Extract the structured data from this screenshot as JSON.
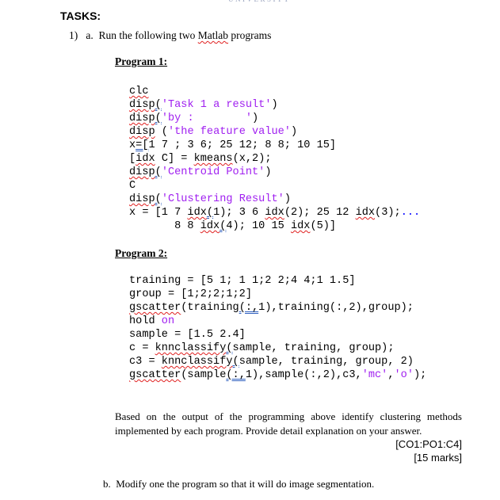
{
  "header": {
    "university_label": "UNIVERSITY",
    "section_title": "TASKS:"
  },
  "task1": {
    "number": "1)",
    "part_a_label": "a.",
    "part_a_text_before": "Run the following two ",
    "part_a_text_flagged": "Matlab",
    "part_a_text_after": " programs"
  },
  "program1": {
    "heading": "Program 1:",
    "lines": [
      [
        {
          "t": "clc",
          "s": "squig"
        }
      ],
      [
        {
          "t": "disp",
          "s": "squig"
        },
        {
          "t": "(",
          "s": "dbl"
        },
        {
          "t": "'Task 1 a result'",
          "s": "str"
        },
        {
          "t": ")"
        }
      ],
      [
        {
          "t": "disp",
          "s": "squig"
        },
        {
          "t": "(",
          "s": "dbl"
        },
        {
          "t": "'by :        '",
          "s": "str"
        },
        {
          "t": ")"
        }
      ],
      [
        {
          "t": "disp",
          "s": "squig"
        },
        {
          "t": " ("
        },
        {
          "t": "'the feature value'",
          "s": "str"
        },
        {
          "t": ")"
        }
      ],
      [
        {
          "t": "x"
        },
        {
          "t": "=[",
          "s": "dbl"
        },
        {
          "t": "1 7 ; 3 6; 25 12; 8 8; 10 15]"
        }
      ],
      [
        {
          "t": "["
        },
        {
          "t": "idx",
          "s": "squig"
        },
        {
          "t": " C] = "
        },
        {
          "t": "kmeans",
          "s": "squig"
        },
        {
          "t": "(x,2);"
        }
      ],
      [
        {
          "t": "disp",
          "s": "squig"
        },
        {
          "t": "(",
          "s": "dbl"
        },
        {
          "t": "'Centroid Point'",
          "s": "str"
        },
        {
          "t": ")"
        }
      ],
      [
        {
          "t": "C"
        }
      ],
      [
        {
          "t": "disp",
          "s": "squig"
        },
        {
          "t": "(",
          "s": "dbl"
        },
        {
          "t": "'Clustering Result'",
          "s": "str"
        },
        {
          "t": ")"
        }
      ],
      [
        {
          "t": "x = [1 7 "
        },
        {
          "t": "idx",
          "s": "squig"
        },
        {
          "t": "(",
          "s": "dbl"
        },
        {
          "t": "1); 3 6 "
        },
        {
          "t": "idx",
          "s": "squig"
        },
        {
          "t": "(2); 25 12 "
        },
        {
          "t": "idx",
          "s": "squig"
        },
        {
          "t": "(3);"
        },
        {
          "t": "...",
          "s": "cont"
        }
      ],
      [
        {
          "t": "       8 8 "
        },
        {
          "t": "idx",
          "s": "squig"
        },
        {
          "t": "(",
          "s": "dbl"
        },
        {
          "t": "4); 10 15 "
        },
        {
          "t": "idx",
          "s": "squig"
        },
        {
          "t": "(5)]"
        }
      ]
    ]
  },
  "program2": {
    "heading": "Program 2:",
    "lines": [
      [
        {
          "t": "training = [5 1; 1 1;2 2;4 4;1 1.5]"
        }
      ],
      [
        {
          "t": "group = [1;2;2;1;2]"
        }
      ],
      [
        {
          "t": "gscatter",
          "s": "squig"
        },
        {
          "t": "(training"
        },
        {
          "t": "(:,",
          "s": "dbl"
        },
        {
          "t": "1),training(:,2),group);"
        }
      ],
      [
        {
          "t": "hold "
        },
        {
          "t": "on",
          "s": "kw"
        }
      ],
      [
        {
          "t": "sample = [1.5 2.4]"
        }
      ],
      [
        {
          "t": "c = "
        },
        {
          "t": "knnclassify",
          "s": "squig"
        },
        {
          "t": "(",
          "s": "dbl"
        },
        {
          "t": "sample, training, group);"
        }
      ],
      [
        {
          "t": "c3 = "
        },
        {
          "t": "knnclassify",
          "s": "squig"
        },
        {
          "t": "(",
          "s": "dbl"
        },
        {
          "t": "sample, training, group, 2)"
        }
      ],
      [
        {
          "t": "gscatter",
          "s": "squig"
        },
        {
          "t": "(sample"
        },
        {
          "t": "(:,",
          "s": "dbl"
        },
        {
          "t": "1),sample(:,2),c3,"
        },
        {
          "t": "'mc'",
          "s": "str"
        },
        {
          "t": ","
        },
        {
          "t": "'o'",
          "s": "str"
        },
        {
          "t": ");"
        }
      ]
    ]
  },
  "question": {
    "line1": "Based on the output of the programming above identify clustering methods",
    "line2": "implemented by each program. Provide detail explanation on your answer.",
    "outcome_code": "[CO1:PO1:C4]",
    "marks": "[15 marks]"
  },
  "part_b": {
    "label": "b.",
    "text": "Modify one the program so that it will do image segmentation."
  },
  "colors": {
    "string": "#a020f0",
    "continuation": "#0000ff",
    "spell_squiggle": "#e02020",
    "grammar_underline": "#3060c0"
  }
}
